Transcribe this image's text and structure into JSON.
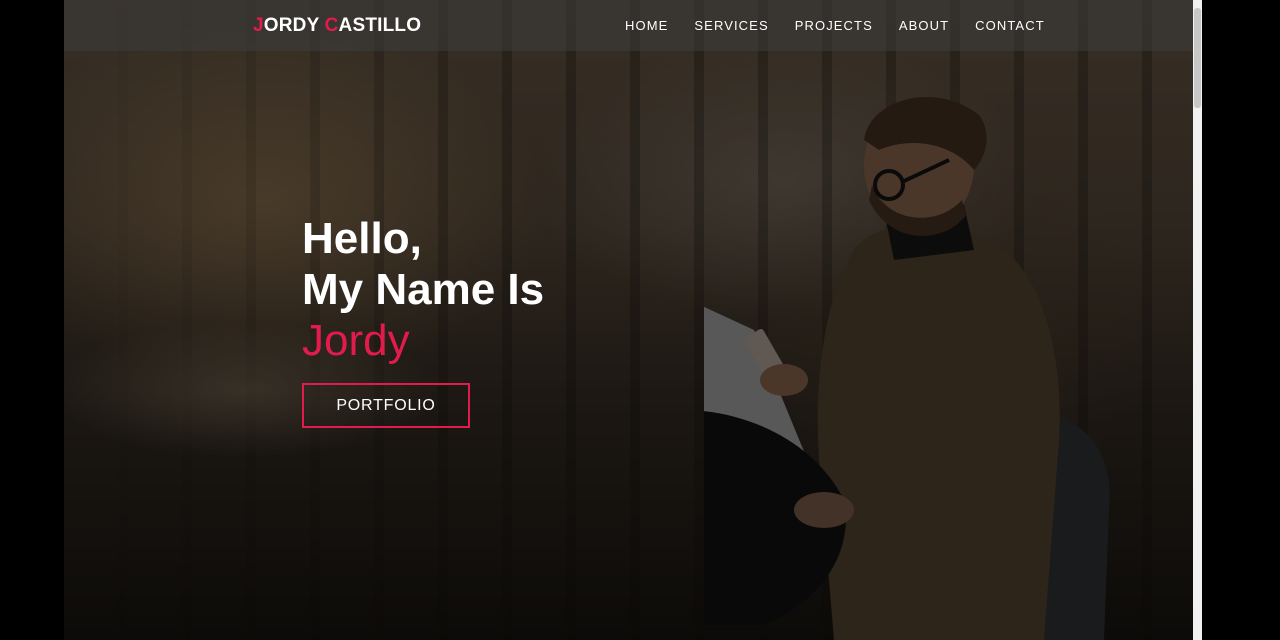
{
  "header": {
    "brand": {
      "first_initial": "J",
      "first_rest": "ORDY ",
      "last_initial": "C",
      "last_rest": "ASTILLO"
    },
    "nav": [
      {
        "label": "HOME"
      },
      {
        "label": "SERVICES"
      },
      {
        "label": "PROJECTS"
      },
      {
        "label": "ABOUT"
      },
      {
        "label": "CONTACT"
      }
    ]
  },
  "hero": {
    "line1": "Hello,",
    "line2": "My Name Is",
    "name": "Jordy",
    "cta_label": "PORTFOLIO"
  },
  "colors": {
    "accent": "#e31b4d",
    "text": "#ffffff",
    "header_bg": "rgba(60,60,60,0.55)"
  },
  "icons": {
    "hero_image": "photo-man-with-laptop-and-phone"
  }
}
